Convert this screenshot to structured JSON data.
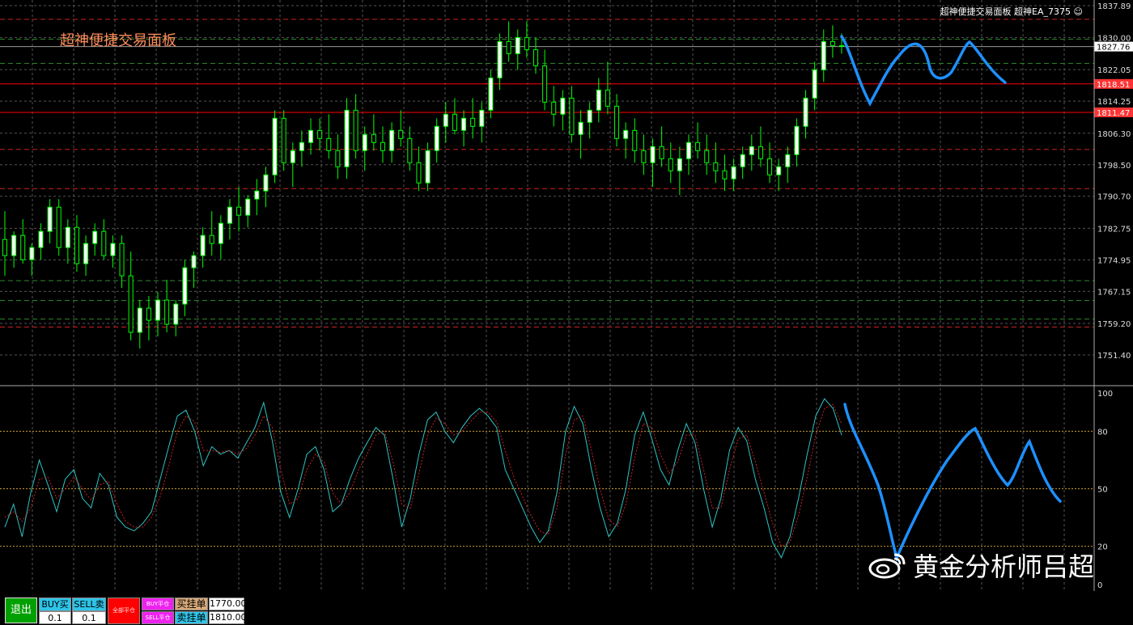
{
  "colors": {
    "background": "#000000",
    "candle": "#00ff00",
    "candle_bull_body": "#ffffff",
    "grid": "#6a6a6a",
    "level_red": "#ff0000",
    "level_red_dash": "#cc2222",
    "level_green_dash": "#2e8b2e",
    "stoch_main": "#2ec4c4",
    "stoch_signal": "#cc2222",
    "stoch_level": "#c8a030",
    "annotation": "#1e90ff",
    "title_cn": "#ff8c5a",
    "tag_red": "#ff3333",
    "tag_current": "#ffffff"
  },
  "panel": {
    "exit_label": "退出",
    "buy_label": "BUY买",
    "sell_label": "SELL卖",
    "buy_lot": "0.1",
    "sell_lot": "0.1",
    "close_all_label": "全部平仓",
    "buy_close_label": "BUY平仓",
    "sell_close_label": "SELL平仓",
    "buy_pending_label": "买挂单",
    "sell_pending_label": "卖挂单",
    "buy_pending_price": "1770.00",
    "sell_pending_price": "1810.00",
    "title": "超神便捷交易面板"
  },
  "header_info": "超神便捷交易面板 超神EA_7375 ☺",
  "watermark": "黄金分析师吕超",
  "chart_data": [
    {
      "type": "candlestick",
      "title": "",
      "ylim": [
        1747.0,
        1837.89
      ],
      "y_ticks": [
        "1837.89",
        "1830.00",
        "1822.05",
        "1814.25",
        "1806.30",
        "1798.50",
        "1790.70",
        "1782.75",
        "1774.95",
        "1767.15",
        "1759.20",
        "1751.40"
      ],
      "price_tags": [
        {
          "label": "1827.76",
          "value": 1827.76,
          "kind": "current"
        },
        {
          "label": "1818.51",
          "value": 1818.51,
          "kind": "level"
        },
        {
          "label": "1811.47",
          "value": 1811.47,
          "kind": "level"
        }
      ],
      "solid_levels": [
        1818.51,
        1811.47
      ],
      "red_dashed_levels": [
        1834.5,
        1802.3,
        1792.6,
        1758.3
      ],
      "green_dashed_levels": [
        1829.6,
        1823.6,
        1769.8,
        1764.9,
        1760.3
      ],
      "gray_level": 1827.76,
      "grid": true,
      "candles_ohlc": [
        [
          1780,
          1787,
          1771,
          1776
        ],
        [
          1776,
          1782,
          1773,
          1781
        ],
        [
          1781,
          1785,
          1774,
          1775
        ],
        [
          1775,
          1779,
          1771,
          1778
        ],
        [
          1778,
          1784,
          1775,
          1782
        ],
        [
          1782,
          1790,
          1779,
          1788
        ],
        [
          1788,
          1790,
          1776,
          1778
        ],
        [
          1778,
          1785,
          1774,
          1783
        ],
        [
          1783,
          1786,
          1772,
          1774
        ],
        [
          1774,
          1781,
          1771,
          1779
        ],
        [
          1779,
          1784,
          1776,
          1782
        ],
        [
          1782,
          1785,
          1775,
          1776
        ],
        [
          1776,
          1781,
          1773,
          1779
        ],
        [
          1779,
          1781,
          1768,
          1771
        ],
        [
          1771,
          1777,
          1755,
          1757
        ],
        [
          1757,
          1765,
          1753,
          1763
        ],
        [
          1763,
          1766,
          1755,
          1760
        ],
        [
          1760,
          1767,
          1756,
          1765
        ],
        [
          1765,
          1770,
          1757,
          1759
        ],
        [
          1759,
          1765,
          1756,
          1764
        ],
        [
          1764,
          1775,
          1761,
          1773
        ],
        [
          1773,
          1777,
          1768,
          1776
        ],
        [
          1776,
          1783,
          1773,
          1781
        ],
        [
          1781,
          1787,
          1776,
          1779
        ],
        [
          1779,
          1786,
          1775,
          1784
        ],
        [
          1784,
          1790,
          1780,
          1788
        ],
        [
          1788,
          1793,
          1782,
          1786
        ],
        [
          1786,
          1791,
          1783,
          1790
        ],
        [
          1790,
          1795,
          1786,
          1792
        ],
        [
          1792,
          1798,
          1788,
          1796
        ],
        [
          1796,
          1812,
          1794,
          1810
        ],
        [
          1810,
          1812,
          1797,
          1799
        ],
        [
          1799,
          1804,
          1793,
          1802
        ],
        [
          1802,
          1807,
          1798,
          1804
        ],
        [
          1804,
          1810,
          1801,
          1807
        ],
        [
          1807,
          1810,
          1802,
          1805
        ],
        [
          1805,
          1811,
          1800,
          1802
        ],
        [
          1802,
          1806,
          1795,
          1798
        ],
        [
          1798,
          1815,
          1795,
          1812
        ],
        [
          1812,
          1816,
          1800,
          1802
        ],
        [
          1802,
          1808,
          1797,
          1806
        ],
        [
          1806,
          1811,
          1802,
          1804
        ],
        [
          1804,
          1808,
          1799,
          1802
        ],
        [
          1802,
          1809,
          1799,
          1807
        ],
        [
          1807,
          1812,
          1803,
          1805
        ],
        [
          1805,
          1808,
          1797,
          1799
        ],
        [
          1799,
          1803,
          1792,
          1794
        ],
        [
          1794,
          1804,
          1792,
          1802
        ],
        [
          1802,
          1810,
          1799,
          1808
        ],
        [
          1808,
          1814,
          1804,
          1811
        ],
        [
          1811,
          1815,
          1806,
          1807
        ],
        [
          1807,
          1812,
          1803,
          1810
        ],
        [
          1810,
          1815,
          1805,
          1808
        ],
        [
          1808,
          1814,
          1804,
          1812
        ],
        [
          1812,
          1822,
          1810,
          1820
        ],
        [
          1820,
          1831,
          1817,
          1829
        ],
        [
          1829,
          1834,
          1824,
          1826
        ],
        [
          1826,
          1832,
          1822,
          1830
        ],
        [
          1830,
          1834,
          1825,
          1827
        ],
        [
          1827,
          1830,
          1821,
          1823
        ],
        [
          1823,
          1827,
          1812,
          1814
        ],
        [
          1814,
          1818,
          1808,
          1811
        ],
        [
          1811,
          1817,
          1807,
          1815
        ],
        [
          1815,
          1818,
          1804,
          1806
        ],
        [
          1806,
          1812,
          1800,
          1809
        ],
        [
          1809,
          1814,
          1805,
          1812
        ],
        [
          1812,
          1820,
          1809,
          1817
        ],
        [
          1817,
          1824,
          1811,
          1813
        ],
        [
          1813,
          1816,
          1803,
          1805
        ],
        [
          1805,
          1809,
          1800,
          1807
        ],
        [
          1807,
          1810,
          1799,
          1802
        ],
        [
          1802,
          1806,
          1796,
          1799
        ],
        [
          1799,
          1805,
          1793,
          1803
        ],
        [
          1803,
          1808,
          1798,
          1800
        ],
        [
          1800,
          1804,
          1794,
          1797
        ],
        [
          1797,
          1803,
          1791,
          1800
        ],
        [
          1800,
          1806,
          1796,
          1804
        ],
        [
          1804,
          1809,
          1800,
          1802
        ],
        [
          1802,
          1806,
          1796,
          1799
        ],
        [
          1799,
          1804,
          1794,
          1797
        ],
        [
          1797,
          1801,
          1792,
          1795
        ],
        [
          1795,
          1800,
          1792,
          1798
        ],
        [
          1798,
          1803,
          1795,
          1801
        ],
        [
          1801,
          1806,
          1797,
          1803
        ],
        [
          1803,
          1808,
          1798,
          1800
        ],
        [
          1800,
          1804,
          1794,
          1796
        ],
        [
          1796,
          1800,
          1792,
          1798
        ],
        [
          1798,
          1803,
          1794,
          1801
        ],
        [
          1801,
          1810,
          1798,
          1808
        ],
        [
          1808,
          1817,
          1805,
          1815
        ],
        [
          1815,
          1824,
          1812,
          1822
        ],
        [
          1822,
          1832,
          1819,
          1829
        ],
        [
          1829,
          1833,
          1825,
          1828
        ],
        [
          1828,
          1831,
          1826,
          1828
        ]
      ]
    },
    {
      "type": "line",
      "title": "",
      "ylim": [
        0,
        100
      ],
      "y_ticks": [
        "100",
        "80",
        "50",
        "20",
        "0"
      ],
      "levels": [
        80,
        50,
        20
      ],
      "series": [
        {
          "values": [
            30,
            42,
            25,
            48,
            65,
            52,
            38,
            55,
            60,
            45,
            40,
            58,
            52,
            35,
            30,
            28,
            32,
            38,
            55,
            72,
            88,
            91,
            80,
            62,
            72,
            68,
            70,
            66,
            74,
            82,
            95,
            75,
            48,
            35,
            50,
            68,
            72,
            60,
            38,
            42,
            55,
            66,
            74,
            82,
            78,
            55,
            30,
            45,
            68,
            86,
            90,
            80,
            74,
            82,
            88,
            92,
            88,
            82,
            60,
            50,
            40,
            30,
            22,
            28,
            48,
            80,
            93,
            84,
            60,
            40,
            25,
            32,
            50,
            78,
            90,
            76,
            60,
            52,
            70,
            84,
            74,
            50,
            30,
            45,
            70,
            82,
            75,
            55,
            40,
            22,
            14,
            25,
            45,
            68,
            88,
            97,
            92,
            78
          ]
        },
        {
          "values": [
            35,
            38,
            33,
            40,
            55,
            56,
            45,
            50,
            56,
            50,
            44,
            52,
            54,
            42,
            33,
            30,
            30,
            35,
            46,
            62,
            80,
            88,
            85,
            70,
            70,
            69,
            70,
            68,
            71,
            78,
            88,
            82,
            60,
            42,
            45,
            60,
            68,
            64,
            48,
            42,
            48,
            60,
            68,
            78,
            80,
            64,
            42,
            40,
            58,
            78,
            87,
            84,
            78,
            80,
            85,
            90,
            90,
            85,
            70,
            56,
            46,
            36,
            28,
            26,
            40,
            68,
            86,
            88,
            70,
            50,
            34,
            30,
            42,
            66,
            84,
            82,
            68,
            58,
            64,
            78,
            78,
            60,
            40,
            40,
            60,
            76,
            78,
            64,
            48,
            32,
            20,
            22,
            36,
            56,
            78,
            92,
            94,
            84
          ]
        }
      ]
    }
  ]
}
